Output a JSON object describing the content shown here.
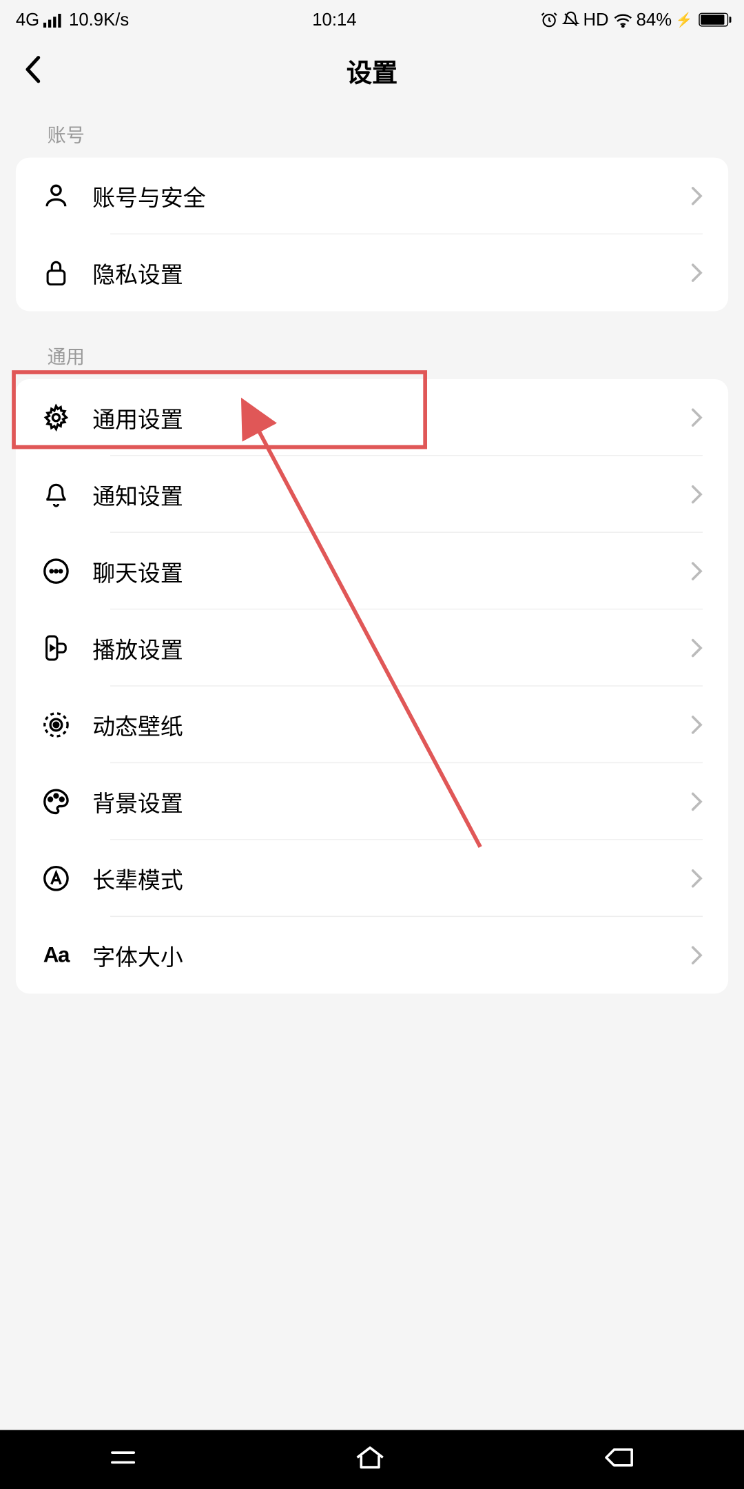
{
  "status": {
    "network": "4G",
    "speed": "10.9K/s",
    "time": "10:14",
    "hd": "HD",
    "battery_pct": "84%"
  },
  "header": {
    "title": "设置"
  },
  "sections": {
    "account": {
      "label": "账号",
      "items": [
        {
          "label": "账号与安全"
        },
        {
          "label": "隐私设置"
        }
      ]
    },
    "general": {
      "label": "通用",
      "items": [
        {
          "label": "通用设置"
        },
        {
          "label": "通知设置"
        },
        {
          "label": "聊天设置"
        },
        {
          "label": "播放设置"
        },
        {
          "label": "动态壁纸"
        },
        {
          "label": "背景设置"
        },
        {
          "label": "长辈模式"
        },
        {
          "label": "字体大小"
        }
      ]
    }
  }
}
